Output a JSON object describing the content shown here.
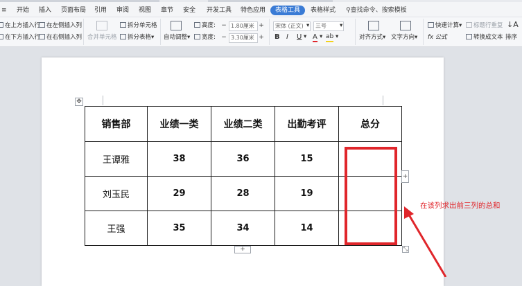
{
  "tabs": [
    "开始",
    "插入",
    "页面布局",
    "引用",
    "审阅",
    "视图",
    "章节",
    "安全",
    "开发工具",
    "特色应用",
    "表格工具",
    "表格样式",
    "查找命令、搜索模板"
  ],
  "active_tab": "表格工具",
  "ribbon": {
    "insert_above": "在上方插入行",
    "insert_below": "在下方插入行",
    "insert_left": "在左侧插入列",
    "insert_right": "在右侧插入列",
    "merge_cells": "合并单元格",
    "split_cells": "拆分单元格",
    "split_table": "拆分表格",
    "auto_fit": "自动调整",
    "height_label": "高度:",
    "height_value": "1.80厘米",
    "width_label": "宽度:",
    "width_value": "3.30厘米",
    "font_name": "宋体 (正文)",
    "font_size": "三号",
    "bold": "B",
    "italic": "I",
    "underline": "U",
    "font_color": "A",
    "highlight": "ab",
    "align": "对齐方式",
    "text_direction": "文字方向",
    "quick_calc": "快速计算",
    "repeat_title": "标题行重复",
    "formula": "fx 公式",
    "convert_text": "转换成文本",
    "sort": "排序"
  },
  "table": {
    "headers": [
      "销售部",
      "业绩一类",
      "业绩二类",
      "出勤考评",
      "总分"
    ],
    "rows": [
      [
        "王谭雅",
        "38",
        "36",
        "15",
        ""
      ],
      [
        "刘玉民",
        "29",
        "28",
        "19",
        ""
      ],
      [
        "王强",
        "35",
        "34",
        "14",
        ""
      ]
    ]
  },
  "annotation": "在该列求出前三列的总和",
  "colors": {
    "accent": "#3a7bd5",
    "annotation_red": "#e0262b"
  }
}
